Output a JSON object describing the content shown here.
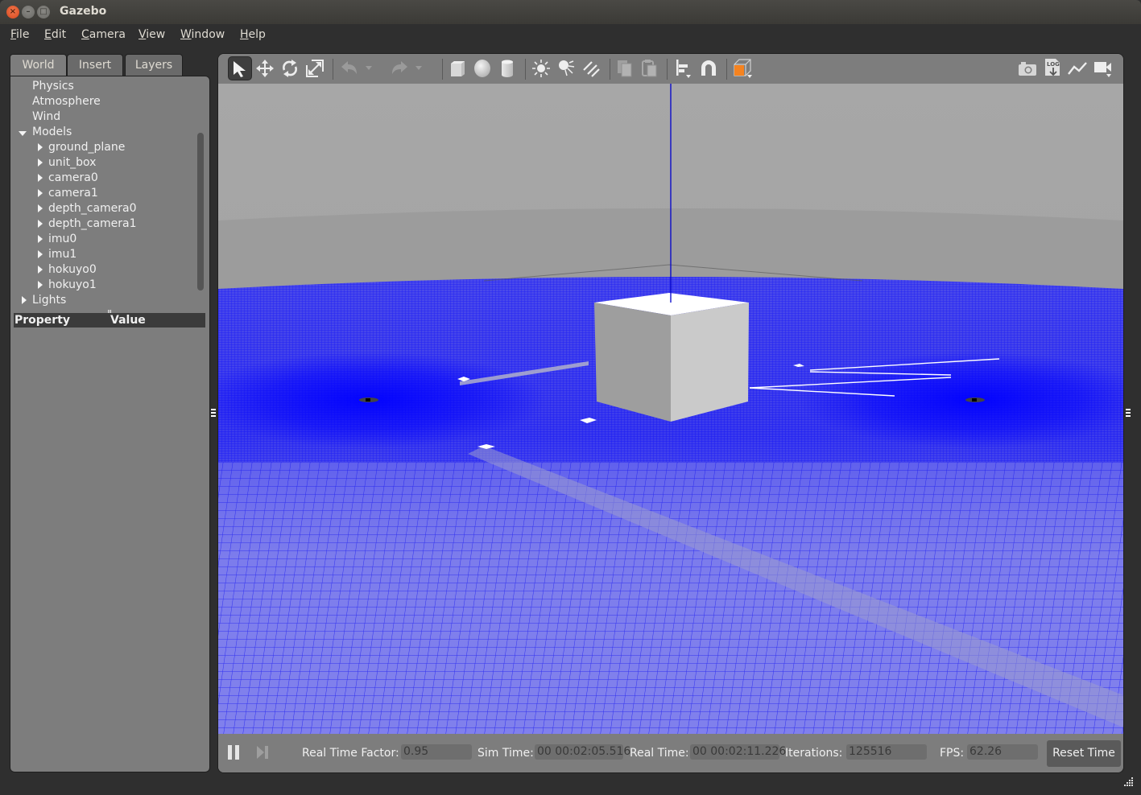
{
  "window": {
    "title": "Gazebo"
  },
  "menu": [
    "File",
    "Edit",
    "Camera",
    "View",
    "Window",
    "Help"
  ],
  "left_panel": {
    "tabs": [
      {
        "label": "World",
        "active": true
      },
      {
        "label": "Insert",
        "active": false
      },
      {
        "label": "Layers",
        "active": false
      }
    ],
    "tree": {
      "physics": "Physics",
      "atmosphere": "Atmosphere",
      "wind": "Wind",
      "models": {
        "label": "Models",
        "expanded": true,
        "children": [
          "ground_plane",
          "unit_box",
          "camera0",
          "camera1",
          "depth_camera0",
          "depth_camera1",
          "imu0",
          "imu1",
          "hokuyo0",
          "hokuyo1"
        ]
      },
      "lights": {
        "label": "Lights",
        "expanded": false
      }
    },
    "property_table": {
      "col_property": "Property",
      "col_value": "Value"
    }
  },
  "toolbar": {
    "left": [
      {
        "icon": "select-arrow-icon",
        "active": true
      },
      {
        "icon": "translate-icon"
      },
      {
        "icon": "rotate-icon"
      },
      {
        "icon": "scale-icon"
      },
      {
        "icon": "undo-icon",
        "enabled": false
      },
      {
        "icon": "redo-icon",
        "enabled": false
      },
      {
        "icon": "box-shape-icon"
      },
      {
        "icon": "sphere-shape-icon"
      },
      {
        "icon": "cylinder-shape-icon"
      },
      {
        "icon": "point-light-icon"
      },
      {
        "icon": "spot-light-icon"
      },
      {
        "icon": "directional-light-icon"
      },
      {
        "icon": "copy-icon",
        "enabled": false
      },
      {
        "icon": "paste-icon",
        "enabled": false
      },
      {
        "icon": "align-icon"
      },
      {
        "icon": "snap-magnet-icon"
      },
      {
        "icon": "view-angle-icon"
      }
    ],
    "right": [
      {
        "icon": "screenshot-camera-icon"
      },
      {
        "icon": "log-icon",
        "text": "LOG"
      },
      {
        "icon": "plot-icon"
      },
      {
        "icon": "video-record-icon"
      }
    ],
    "accent": "#f58320"
  },
  "scene": {
    "sky_color": "#9b9b9b",
    "ground_grid_color": "#0000ff",
    "models_visible": [
      "unit_box",
      "camera0",
      "camera1",
      "depth_camera0",
      "depth_camera1",
      "hokuyo0",
      "hokuyo1"
    ]
  },
  "status": {
    "real_time_factor_label": "Real Time Factor:",
    "real_time_factor": "0.95",
    "sim_time_label": "Sim Time:",
    "sim_time": "00 00:02:05.516",
    "real_time_label": "Real Time:",
    "real_time": "00 00:02:11.226",
    "iterations_label": "Iterations:",
    "iterations": "125516",
    "fps_label": "FPS:",
    "fps": "62.26",
    "reset_label": "Reset Time"
  }
}
